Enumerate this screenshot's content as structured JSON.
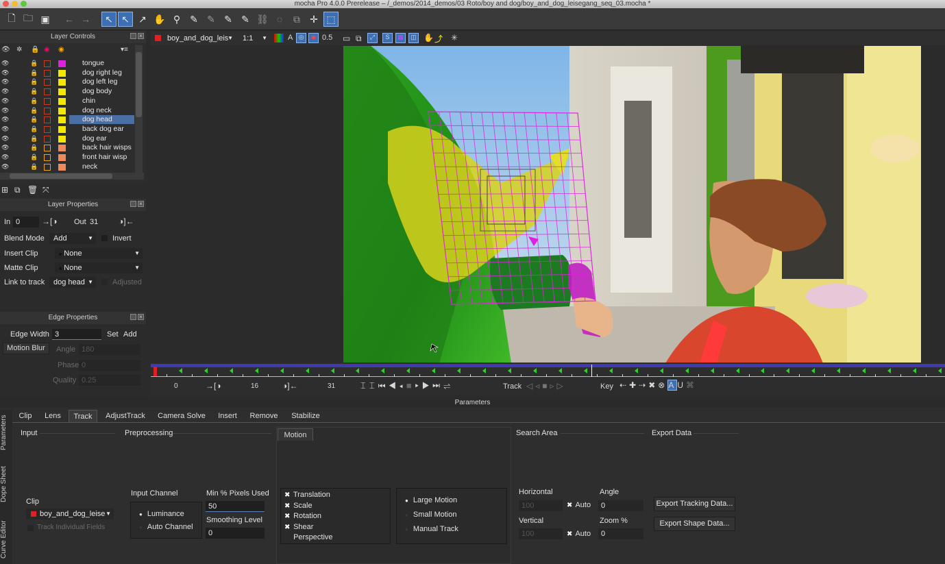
{
  "window": {
    "title": "mocha Pro 4.0.0 Prerelease – /_demos/2014_demos/03 Roto/boy and dog/boy_and_dog_leisegang_seq_03.mocha *"
  },
  "layer_controls": {
    "title": "Layer Controls",
    "layers": [
      {
        "name": "tongue",
        "color": "#e020e0"
      },
      {
        "name": "dog right leg",
        "color": "#f5e800"
      },
      {
        "name": "dog left leg",
        "color": "#f5e800"
      },
      {
        "name": "dog body",
        "color": "#f5e800"
      },
      {
        "name": "chin",
        "color": "#f5e800"
      },
      {
        "name": "dog neck",
        "color": "#f5e800"
      },
      {
        "name": "dog head",
        "color": "#f5e800",
        "selected": true
      },
      {
        "name": "back dog ear",
        "color": "#f5e800"
      },
      {
        "name": "dog ear",
        "color": "#f5e800"
      },
      {
        "name": "back hair wisps",
        "color": "#f08a5a"
      },
      {
        "name": "front hair wisp",
        "color": "#f08a5a"
      },
      {
        "name": "neck",
        "color": "#f08a5a"
      }
    ]
  },
  "layer_properties": {
    "title": "Layer Properties",
    "in_label": "In",
    "in_value": "0",
    "out_label": "Out",
    "out_value": "31",
    "blend_mode_label": "Blend Mode",
    "blend_mode_value": "Add",
    "invert_label": "Invert",
    "insert_clip_label": "Insert Clip",
    "insert_clip_value": "None",
    "matte_clip_label": "Matte Clip",
    "matte_clip_value": "None",
    "link_to_track_label": "Link to track",
    "link_to_track_value": "dog head",
    "adjusted_label": "Adjusted"
  },
  "edge_properties": {
    "title": "Edge Properties",
    "edge_width_label": "Edge Width",
    "edge_width_value": "3",
    "set_label": "Set",
    "add_label": "Add",
    "motion_blur_label": "Motion Blur",
    "angle_label": "Angle",
    "angle_value": "180",
    "phase_label": "Phase",
    "phase_value": "0",
    "quality_label": "Quality",
    "quality_value": "0.25"
  },
  "viewer_bar": {
    "clip_name": "boy_and_dog_leis",
    "zoom": "1:1",
    "opacity": "0.5"
  },
  "timeline": {
    "start": "0",
    "current": "16",
    "end": "31",
    "track_label": "Track",
    "key_label": "Key",
    "playhead_fraction": 0.555
  },
  "parameters": {
    "title": "Parameters",
    "tabs": [
      "Clip",
      "Lens",
      "Track",
      "AdjustTrack",
      "Camera Solve",
      "Insert",
      "Remove",
      "Stabilize"
    ],
    "active_tab": "Track",
    "side_tabs": [
      "Parameters",
      "Dope Sheet",
      "Curve Editor"
    ],
    "input": {
      "title": "Input",
      "clip_label": "Clip",
      "clip_value": "boy_and_dog_leise",
      "track_fields_label": "Track Individual Fields"
    },
    "preprocessing": {
      "title": "Preprocessing",
      "input_channel_label": "Input Channel",
      "luminance_label": "Luminance",
      "auto_channel_label": "Auto Channel",
      "min_pixels_label": "Min % Pixels Used",
      "min_pixels_value": "50",
      "smoothing_label": "Smoothing Level",
      "smoothing_value": "0"
    },
    "motion": {
      "title": "Motion",
      "options": [
        {
          "label": "Translation",
          "checked": true
        },
        {
          "label": "Scale",
          "checked": true
        },
        {
          "label": "Rotation",
          "checked": true
        },
        {
          "label": "Shear",
          "checked": true
        },
        {
          "label": "Perspective",
          "checked": false
        }
      ],
      "modes": [
        {
          "label": "Large Motion",
          "selected": true
        },
        {
          "label": "Small Motion",
          "selected": false
        },
        {
          "label": "Manual Track",
          "selected": false
        }
      ]
    },
    "search_area": {
      "title": "Search Area",
      "horizontal_label": "Horizontal",
      "horizontal_value": "100",
      "vertical_label": "Vertical",
      "vertical_value": "100",
      "auto_label": "Auto",
      "angle_label": "Angle",
      "angle_value": "0",
      "zoom_label": "Zoom %",
      "zoom_value": "0"
    },
    "export_data": {
      "title": "Export Data",
      "export_tracking_label": "Export Tracking Data...",
      "export_shape_label": "Export Shape Data..."
    }
  }
}
